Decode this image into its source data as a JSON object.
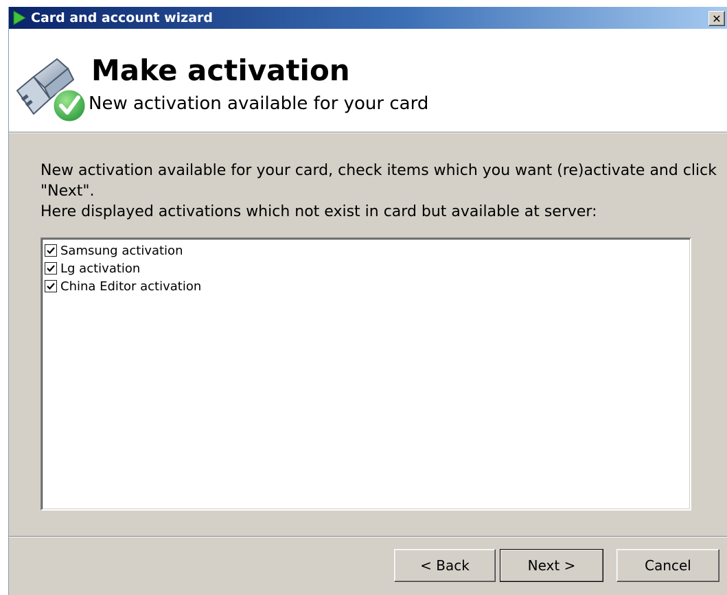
{
  "window": {
    "title": "Card and account wizard",
    "close_glyph": "✕"
  },
  "header": {
    "title": "Make activation",
    "subtitle": "New activation available for your card",
    "icon": "usb-card-check-icon"
  },
  "content": {
    "description_line1": "New activation  available for your card, check items which you want (re)activate and click \"Next\".",
    "description_line2": "Here displayed activations which not exist in card but available at server:"
  },
  "activations": [
    {
      "label": "Samsung activation",
      "checked": true
    },
    {
      "label": "Lg activation",
      "checked": true
    },
    {
      "label": "China Editor activation",
      "checked": true
    }
  ],
  "buttons": {
    "back": "< Back",
    "next": "Next >",
    "cancel": "Cancel"
  },
  "colors": {
    "titlebar_start": "#0a246a",
    "titlebar_end": "#a6caf0",
    "face": "#d4d0c8",
    "check_green": "#2fa844"
  }
}
